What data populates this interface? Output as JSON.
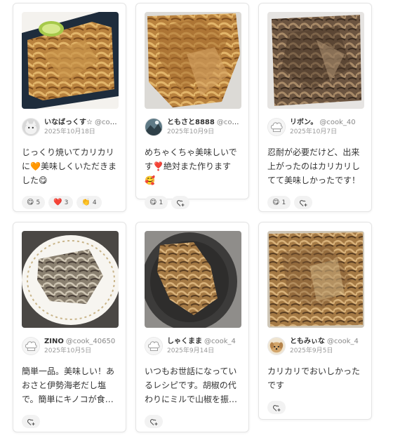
{
  "colors": {
    "accent": "#e05a3a",
    "chip_bg": "#f2f2f2",
    "text": "#333333",
    "muted": "#888888"
  },
  "cards": [
    {
      "name": "いなばっくす☆",
      "handle": "@cook_",
      "date": "2025年10月18日",
      "comment": "じっくり焼いてカリカリに🧡美味しくいただきました😋",
      "reactions": [
        {
          "emoji": "😋",
          "count": "5"
        },
        {
          "emoji": "❤️",
          "count": "3"
        },
        {
          "emoji": "👏",
          "count": "4"
        }
      ],
      "avatar_icon": "cat-avatar-icon",
      "photo": "grilled-fish-plate-photo"
    },
    {
      "name": "ともさと8888",
      "handle": "@cook_",
      "date": "2025年10月9日",
      "comment": "めちゃくちゃ美味しいです❣️絶対また作ります🥰",
      "reactions": [
        {
          "emoji": "😋",
          "count": "1"
        }
      ],
      "avatar_icon": "landscape-avatar-icon",
      "photo": "fried-mushroom-photo"
    },
    {
      "name": "リボン。",
      "handle": "@cook_40",
      "date": "2025年10月7日",
      "comment": "忍耐が必要だけど、出来上がったのはカリカリしてて美味しかったです！",
      "reactions": [
        {
          "emoji": "😋",
          "count": "1"
        }
      ],
      "avatar_icon": "chef-hat-icon",
      "photo": "dark-mushroom-photo"
    },
    {
      "name": "ZINO",
      "handle": "@cook_40650",
      "date": "2025年10月5日",
      "comment": "簡単一品。美味しい！あおさと伊勢海老だし塩で。簡単にキノコが食べられるのは良いですね",
      "reactions": [],
      "avatar_icon": "chef-hat-icon",
      "photo": "mushroom-white-plate-photo"
    },
    {
      "name": "しゃくまま",
      "handle": "@cook_4",
      "date": "2025年9月14日",
      "comment": "いつもお世話になっているレシピです。胡椒の代わりにミルで山椒を振りました",
      "reactions": [],
      "avatar_icon": "chef-hat-icon",
      "photo": "mushroom-dark-plate-photo"
    },
    {
      "name": "ともみぃな",
      "handle": "@cook_4",
      "date": "2025年9月5日",
      "comment": "カリカリでおいしかったです",
      "reactions": [],
      "avatar_icon": "dog-avatar-icon",
      "photo": "mushroom-tray-photo"
    }
  ]
}
